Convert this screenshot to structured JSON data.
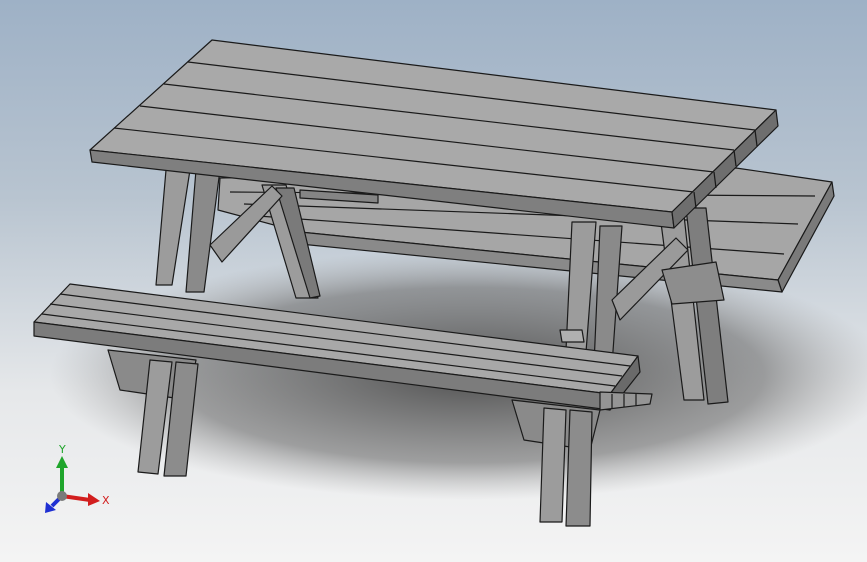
{
  "triad": {
    "x_label": "X",
    "y_label": "Y",
    "x_color": "#d21e1e",
    "y_color": "#1fa52b",
    "z_color": "#1e2fd2"
  },
  "model": {
    "icon": "picnic-table-model",
    "face_light": "#a8a8a8",
    "face_mid": "#8e8e8e",
    "face_dark": "#6f6f6f",
    "edge": "#1a1a1a",
    "shadow": "#5c5c5c"
  }
}
